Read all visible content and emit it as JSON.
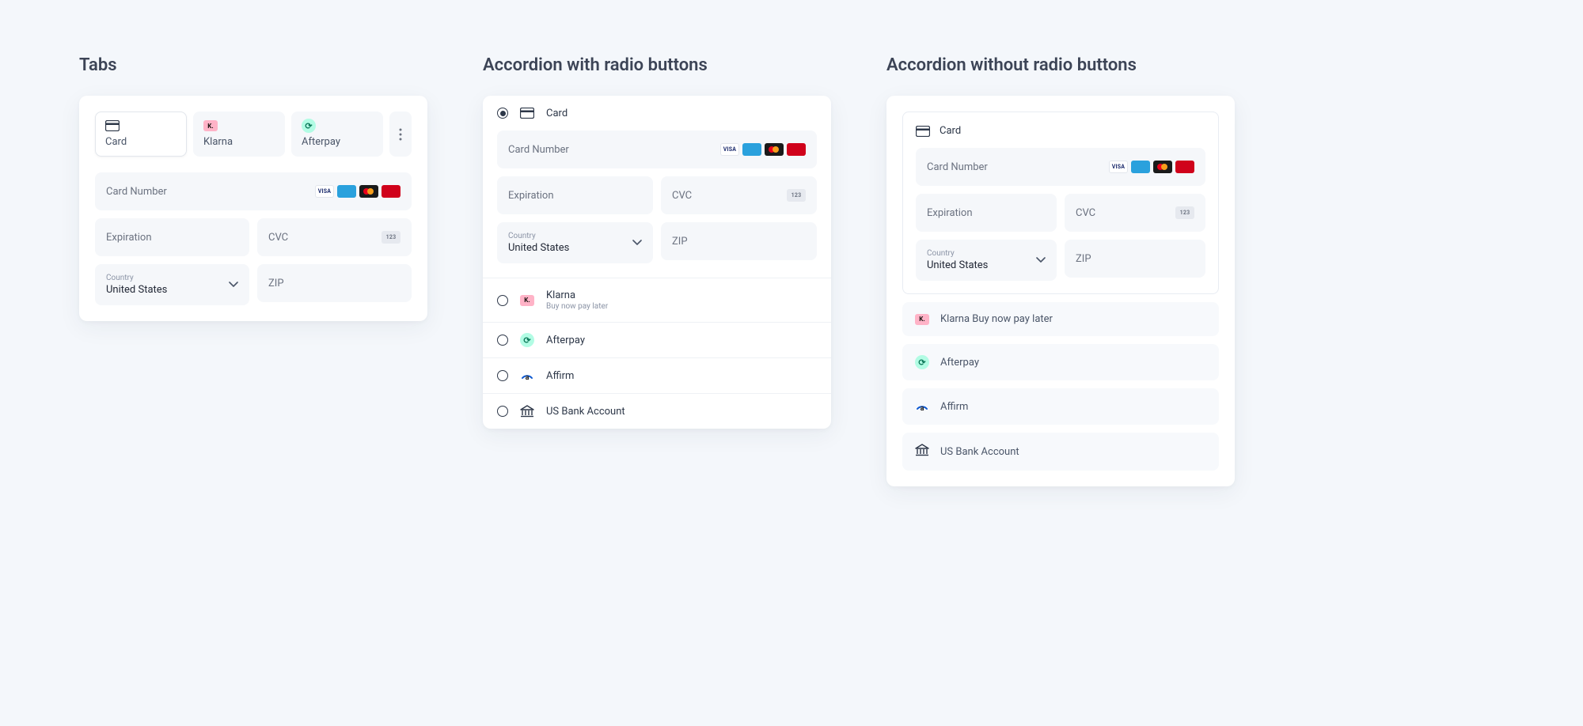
{
  "sections": {
    "tabs_title": "Tabs",
    "accordion_radio_title": "Accordion with radio buttons",
    "accordion_plain_title": "Accordion without radio buttons"
  },
  "tabs": {
    "items": [
      {
        "label": "Card",
        "icon": "card-icon"
      },
      {
        "label": "Klarna",
        "icon": "klarna-icon"
      },
      {
        "label": "Afterpay",
        "icon": "afterpay-icon"
      }
    ]
  },
  "card_form": {
    "number_label": "Card Number",
    "expiration_label": "Expiration",
    "cvc_label": "CVC",
    "country_label": "Country",
    "country_value": "United States",
    "zip_label": "ZIP"
  },
  "payment_methods": {
    "card": {
      "label": "Card"
    },
    "klarna": {
      "label": "Klarna",
      "sublabel": "Buy now pay later"
    },
    "afterpay": {
      "label": "Afterpay"
    },
    "affirm": {
      "label": "Affirm"
    },
    "usbank": {
      "label": "US Bank Account"
    }
  },
  "brands": {
    "visa": "VISA",
    "amex": "AMEX",
    "unionpay": "UnP"
  }
}
